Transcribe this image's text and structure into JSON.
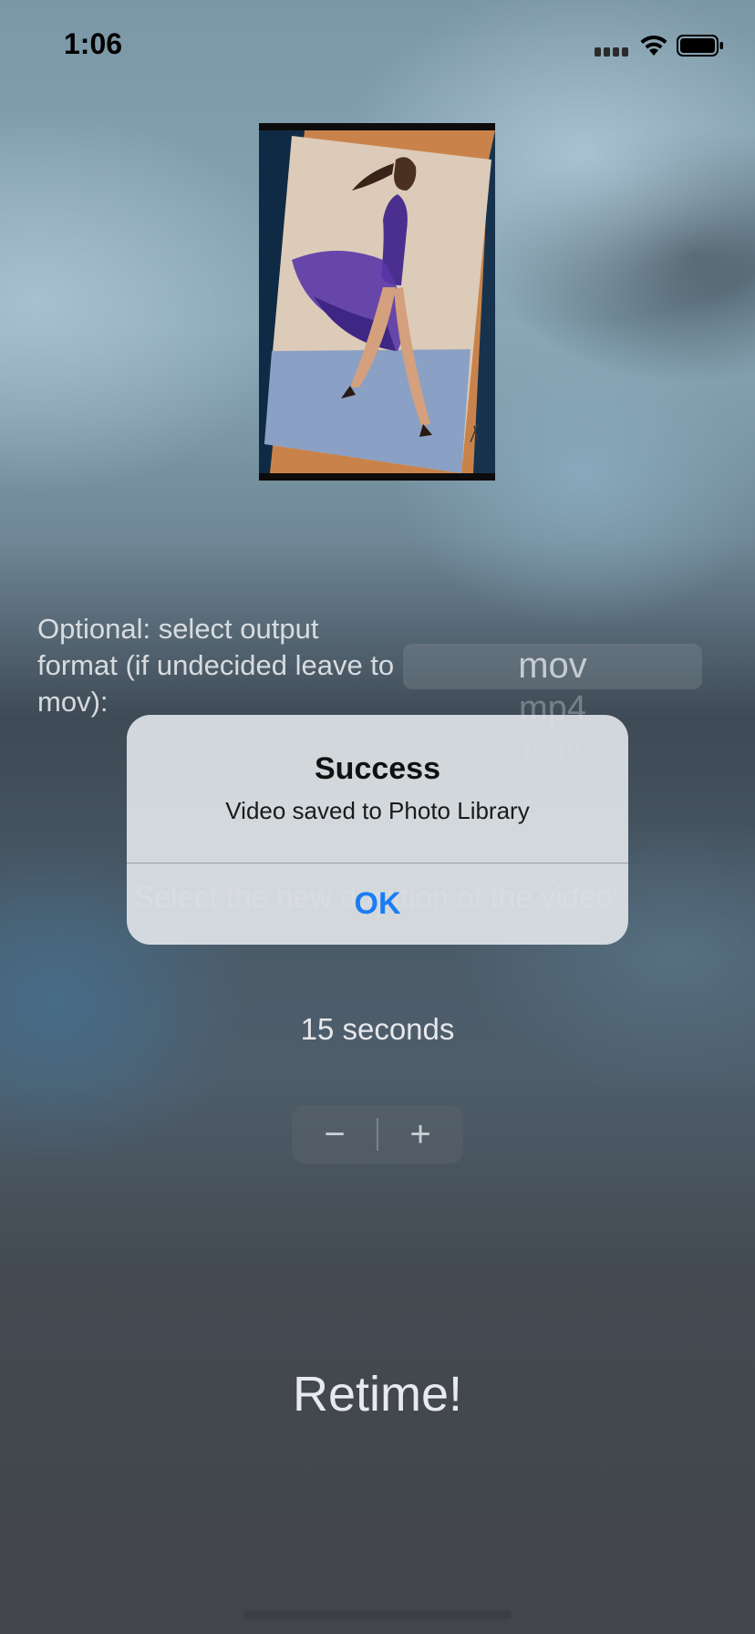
{
  "status_bar": {
    "time": "1:06",
    "icons": [
      "cellular-signal-icon",
      "wifi-icon",
      "battery-icon"
    ]
  },
  "format_section": {
    "label": "Optional: select output format (if undecided leave to mov):",
    "options": [
      "mov",
      "mp4",
      "m4v"
    ],
    "selected": "mov"
  },
  "duration_section": {
    "label": "Select the new duration of the video:",
    "value_text": "15 seconds",
    "stepper": {
      "minus": "−",
      "plus": "+"
    }
  },
  "action_button": "Retime!",
  "alert": {
    "title": "Success",
    "message": "Video saved to Photo Library",
    "button": "OK"
  },
  "colors": {
    "alert_button": "#1c7cf4",
    "alert_background": "#dee2e6"
  }
}
